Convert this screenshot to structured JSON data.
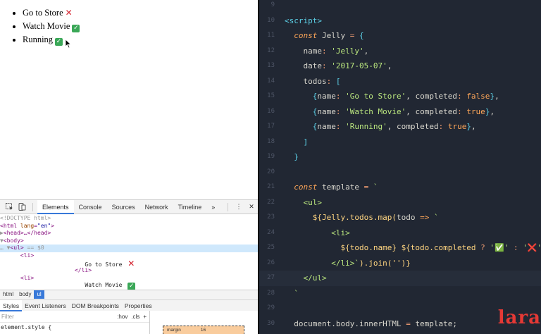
{
  "viewport": {
    "todos": [
      {
        "name": "Go to Store",
        "completed": false,
        "mark": "✕"
      },
      {
        "name": "Watch Movie",
        "completed": true,
        "mark": "✓"
      },
      {
        "name": "Running",
        "completed": true,
        "mark": "✓"
      }
    ]
  },
  "devtools": {
    "tabs": [
      "Elements",
      "Console",
      "Sources",
      "Network",
      "Timeline"
    ],
    "active_tab": "Elements",
    "more_label": "»",
    "menu_label": "⋮",
    "close_label": "✕",
    "dom": {
      "doctype": "<!DOCTYPE html>",
      "html_open": "<html ",
      "html_attr": "lang",
      "html_val": "\"en\"",
      "head_line": "<head>…</head>",
      "body_line": "<body>",
      "ul_line": "<ul>",
      "ul_sel": " == $0",
      "li_open": "<li>",
      "li_text_1": "Go to Store ",
      "li_close": "</li>",
      "li_text_2": "Watch Movie "
    },
    "breadcrumbs": [
      "html",
      "body",
      "ul"
    ],
    "style_tabs": [
      "Styles",
      "Event Listeners",
      "DOM Breakpoints",
      "Properties"
    ],
    "filter_placeholder": "Filter",
    "hov_label": ":hov",
    "cls_label": ".cls",
    "add_label": "+",
    "element_style": "element.style {",
    "margin_label": "margin",
    "margin_value": "16"
  },
  "editor": {
    "lines": [
      {
        "n": "9",
        "segs": []
      },
      {
        "n": "10",
        "segs": [
          [
            "c-tag",
            "<script>"
          ]
        ]
      },
      {
        "n": "11",
        "segs": [
          [
            "c-kw",
            "  const "
          ],
          [
            "c-var",
            "Jelly "
          ],
          [
            "c-op",
            "= "
          ],
          [
            "c-punc",
            "{"
          ]
        ]
      },
      {
        "n": "12",
        "segs": [
          [
            "c-prop",
            "    name"
          ],
          [
            "c-op",
            ": "
          ],
          [
            "c-str",
            "'Jelly'"
          ],
          [
            "c-var",
            ","
          ]
        ]
      },
      {
        "n": "13",
        "segs": [
          [
            "c-prop",
            "    date"
          ],
          [
            "c-op",
            ": "
          ],
          [
            "c-str",
            "'2017-05-07'"
          ],
          [
            "c-var",
            ","
          ]
        ]
      },
      {
        "n": "14",
        "segs": [
          [
            "c-prop",
            "    todos"
          ],
          [
            "c-op",
            ": "
          ],
          [
            "c-punc",
            "["
          ]
        ]
      },
      {
        "n": "15",
        "segs": [
          [
            "c-punc",
            "      {"
          ],
          [
            "c-prop",
            "name"
          ],
          [
            "c-op",
            ": "
          ],
          [
            "c-str",
            "'Go to Store'"
          ],
          [
            "c-var",
            ", completed"
          ],
          [
            "c-op",
            ": "
          ],
          [
            "c-bool",
            "false"
          ],
          [
            "c-punc",
            "}"
          ],
          [
            "c-var",
            ","
          ]
        ]
      },
      {
        "n": "16",
        "segs": [
          [
            "c-punc",
            "      {"
          ],
          [
            "c-prop",
            "name"
          ],
          [
            "c-op",
            ": "
          ],
          [
            "c-str",
            "'Watch Movie'"
          ],
          [
            "c-var",
            ", completed"
          ],
          [
            "c-op",
            ": "
          ],
          [
            "c-bool",
            "true"
          ],
          [
            "c-punc",
            "}"
          ],
          [
            "c-var",
            ","
          ]
        ]
      },
      {
        "n": "17",
        "segs": [
          [
            "c-punc",
            "      {"
          ],
          [
            "c-prop",
            "name"
          ],
          [
            "c-op",
            ": "
          ],
          [
            "c-str",
            "'Running'"
          ],
          [
            "c-var",
            ", completed"
          ],
          [
            "c-op",
            ": "
          ],
          [
            "c-bool",
            "true"
          ],
          [
            "c-punc",
            "}"
          ],
          [
            "c-var",
            ","
          ]
        ]
      },
      {
        "n": "18",
        "segs": [
          [
            "c-punc",
            "    ]"
          ]
        ]
      },
      {
        "n": "19",
        "segs": [
          [
            "c-punc",
            "  }"
          ]
        ]
      },
      {
        "n": "20",
        "segs": []
      },
      {
        "n": "21",
        "segs": [
          [
            "c-kw",
            "  const "
          ],
          [
            "c-var",
            "template "
          ],
          [
            "c-op",
            "= "
          ],
          [
            "c-str",
            "`"
          ]
        ]
      },
      {
        "n": "22",
        "segs": [
          [
            "c-str",
            "    <ul>"
          ]
        ]
      },
      {
        "n": "23",
        "segs": [
          [
            "c-interp",
            "      ${Jelly.todos.map("
          ],
          [
            "c-var",
            "todo "
          ],
          [
            "c-kw",
            "=> "
          ],
          [
            "c-str",
            "`"
          ]
        ]
      },
      {
        "n": "24",
        "segs": [
          [
            "c-str",
            "          <li>"
          ]
        ]
      },
      {
        "n": "25",
        "segs": [
          [
            "c-interp",
            "            ${todo.name} ${todo.completed "
          ],
          [
            "c-op",
            "? "
          ],
          [
            "c-str",
            "'✅' "
          ],
          [
            "c-op",
            ": "
          ],
          [
            "c-str",
            "'❌'"
          ],
          [
            "c-interp",
            "}"
          ]
        ]
      },
      {
        "n": "26",
        "segs": [
          [
            "c-str",
            "          </li>`"
          ],
          [
            "c-interp",
            ").join('')}"
          ]
        ]
      },
      {
        "n": "27",
        "segs": [
          [
            "c-str",
            "    </ul>"
          ]
        ]
      },
      {
        "n": "28",
        "segs": [
          [
            "c-str",
            "  `"
          ]
        ]
      },
      {
        "n": "29",
        "segs": []
      },
      {
        "n": "30",
        "segs": [
          [
            "c-var",
            "  document.body.innerHTML "
          ],
          [
            "c-op",
            "= "
          ],
          [
            "c-var",
            "template;"
          ]
        ]
      }
    ],
    "current_line": "27",
    "watermark": "lara"
  }
}
